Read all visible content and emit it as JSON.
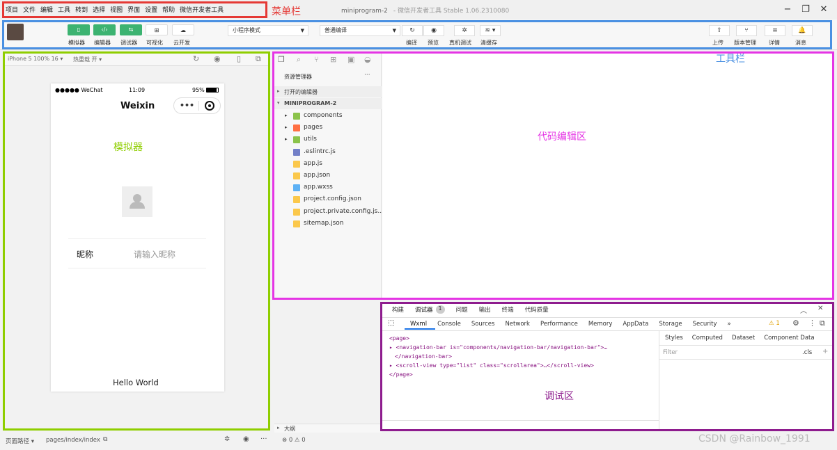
{
  "menu": [
    "项目",
    "文件",
    "编辑",
    "工具",
    "转到",
    "选择",
    "视图",
    "界面",
    "设置",
    "帮助",
    "微信开发者工具"
  ],
  "window": {
    "title": "miniprogram-2",
    "subtitle": "- 微信开发者工具 Stable 1.06.2310080"
  },
  "toolbar": {
    "left_buttons": [
      {
        "icon": "phone-icon",
        "label": "模拟器",
        "style": "green"
      },
      {
        "icon": "code-icon",
        "label": "编辑器",
        "style": "green"
      },
      {
        "icon": "swap-icon",
        "label": "调试器",
        "style": "green"
      },
      {
        "icon": "layout-icon",
        "label": "可视化",
        "style": "white"
      },
      {
        "icon": "cloud-icon",
        "label": "云开发",
        "style": "white"
      }
    ],
    "mode_select": "小程序模式",
    "compile_select": "普通编译",
    "mid_buttons": [
      {
        "icon": "refresh-icon",
        "label": "编译"
      },
      {
        "icon": "eye-icon",
        "label": "预览"
      },
      {
        "icon": "bug-icon",
        "label": "真机调试"
      },
      {
        "icon": "layers-icon",
        "label": "清缓存"
      }
    ],
    "right_buttons": [
      {
        "icon": "upload-icon",
        "label": "上传"
      },
      {
        "icon": "branch-icon",
        "label": "版本管理"
      },
      {
        "icon": "menu-icon",
        "label": "详情"
      },
      {
        "icon": "bell-icon",
        "label": "消息"
      }
    ]
  },
  "simulator": {
    "device": "iPhone 5 100% 16 ▾",
    "hotreload": "热重载 开 ▾",
    "status_signal": "●●●●● WeChat",
    "status_time": "11:09",
    "status_battery": "95%",
    "nav_title": "Weixin",
    "nickname_label": "昵称",
    "nickname_placeholder": "请输入昵称",
    "footer_text": "Hello World"
  },
  "explorer": {
    "title": "资源管理器",
    "more": "···",
    "open_editors": "打开的编辑器",
    "project": "MINIPROGRAM-2",
    "items": [
      {
        "name": "components",
        "kind": "folder",
        "color": "#8bc34a"
      },
      {
        "name": "pages",
        "kind": "folder",
        "color": "#ff7043"
      },
      {
        "name": "utils",
        "kind": "folder",
        "color": "#8bc34a"
      },
      {
        "name": ".eslintrc.js",
        "kind": "file",
        "color": "#5c6bc0"
      },
      {
        "name": "app.js",
        "kind": "file",
        "color": "#fbc02d"
      },
      {
        "name": "app.json",
        "kind": "file",
        "color": "#fbc02d"
      },
      {
        "name": "app.wxss",
        "kind": "file",
        "color": "#42a5f5"
      },
      {
        "name": "project.config.json",
        "kind": "file",
        "color": "#fbc02d"
      },
      {
        "name": "project.private.config.js...",
        "kind": "file",
        "color": "#fbc02d"
      },
      {
        "name": "sitemap.json",
        "kind": "file",
        "color": "#fbc02d"
      }
    ],
    "outline": "大纲",
    "problems": "⊗ 0 ⚠ 0"
  },
  "debugger": {
    "top_tabs": [
      "构建",
      "调试器",
      "问题",
      "输出",
      "终端",
      "代码质量"
    ],
    "badge": "1",
    "tabs": [
      "Wxml",
      "Console",
      "Sources",
      "Network",
      "Performance",
      "Memory",
      "AppData",
      "Storage",
      "Security",
      "»"
    ],
    "warn": "⚠ 1",
    "style_tabs": [
      "Styles",
      "Computed",
      "Dataset",
      "Component Data"
    ],
    "filter_placeholder": "Filter",
    "cls": ".cls",
    "plus": "+",
    "code": [
      {
        "t": "<page>"
      },
      {
        "t": "▸ <navigation-bar is=\"components/navigation-bar/navigation-bar\">…"
      },
      {
        "t": "</navigation-bar>"
      },
      {
        "t": "▸ <scroll-view type=\"list\" class=\"scrollarea\">…</scroll-view>"
      },
      {
        "t": "</page>"
      }
    ]
  },
  "statusbar": {
    "path_label": "页面路径 ▾",
    "path": "pages/index/index"
  },
  "annotations": {
    "menu": "菜单栏",
    "toolbar": "工具栏",
    "simulator": "模拟器",
    "editor": "代码编辑区",
    "debug": "调试区",
    "menu_color": "#e53935",
    "toolbar_color": "#4a90e2",
    "sim_color": "#8fce00",
    "editor_color": "#e535e5",
    "debug_color": "#8e1c8e"
  },
  "watermark": "CSDN @Rainbow_1991"
}
